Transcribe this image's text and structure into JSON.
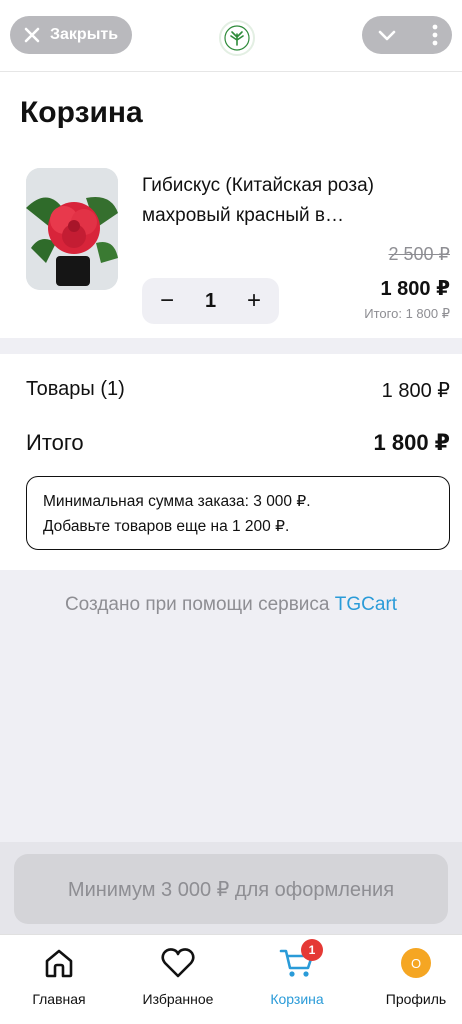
{
  "header": {
    "close_label": "Закрыть",
    "logo_icon": "plant-logo-icon",
    "chevron_icon": "chevron-down-icon",
    "more_icon": "more-vertical-icon"
  },
  "cart": {
    "title": "Корзина",
    "items": [
      {
        "name": "Гибискус (Китайская роза) махровый красный в…",
        "old_price": "2 500 ₽",
        "price": "1 800 ₽",
        "subtotal": "Итого: 1 800 ₽",
        "quantity": "1",
        "minus": "−",
        "plus": "+"
      }
    ]
  },
  "summary": {
    "goods_label": "Товары (1)",
    "goods_value": "1 800 ₽",
    "total_label": "Итого",
    "total_value": "1 800 ₽",
    "notice_line1": "Минимальная сумма заказа: 3 000 ₽.",
    "notice_line2": "Добавьте товаров еще на 1 200 ₽."
  },
  "footer_note": {
    "text": "Создано при помощи сервиса ",
    "link": "TGCart"
  },
  "checkout": {
    "label": "Минимум 3 000 ₽ для оформления"
  },
  "tabs": [
    {
      "label": "Главная",
      "icon": "home-icon"
    },
    {
      "label": "Избранное",
      "icon": "heart-icon"
    },
    {
      "label": "Корзина",
      "icon": "cart-icon",
      "badge": "1",
      "active": true
    },
    {
      "label": "Профиль",
      "icon": "avatar-icon",
      "avatar_letter": "O"
    }
  ],
  "colors": {
    "accent": "#2a9bd8",
    "badge": "#e53935",
    "avatar": "#f5a623"
  }
}
